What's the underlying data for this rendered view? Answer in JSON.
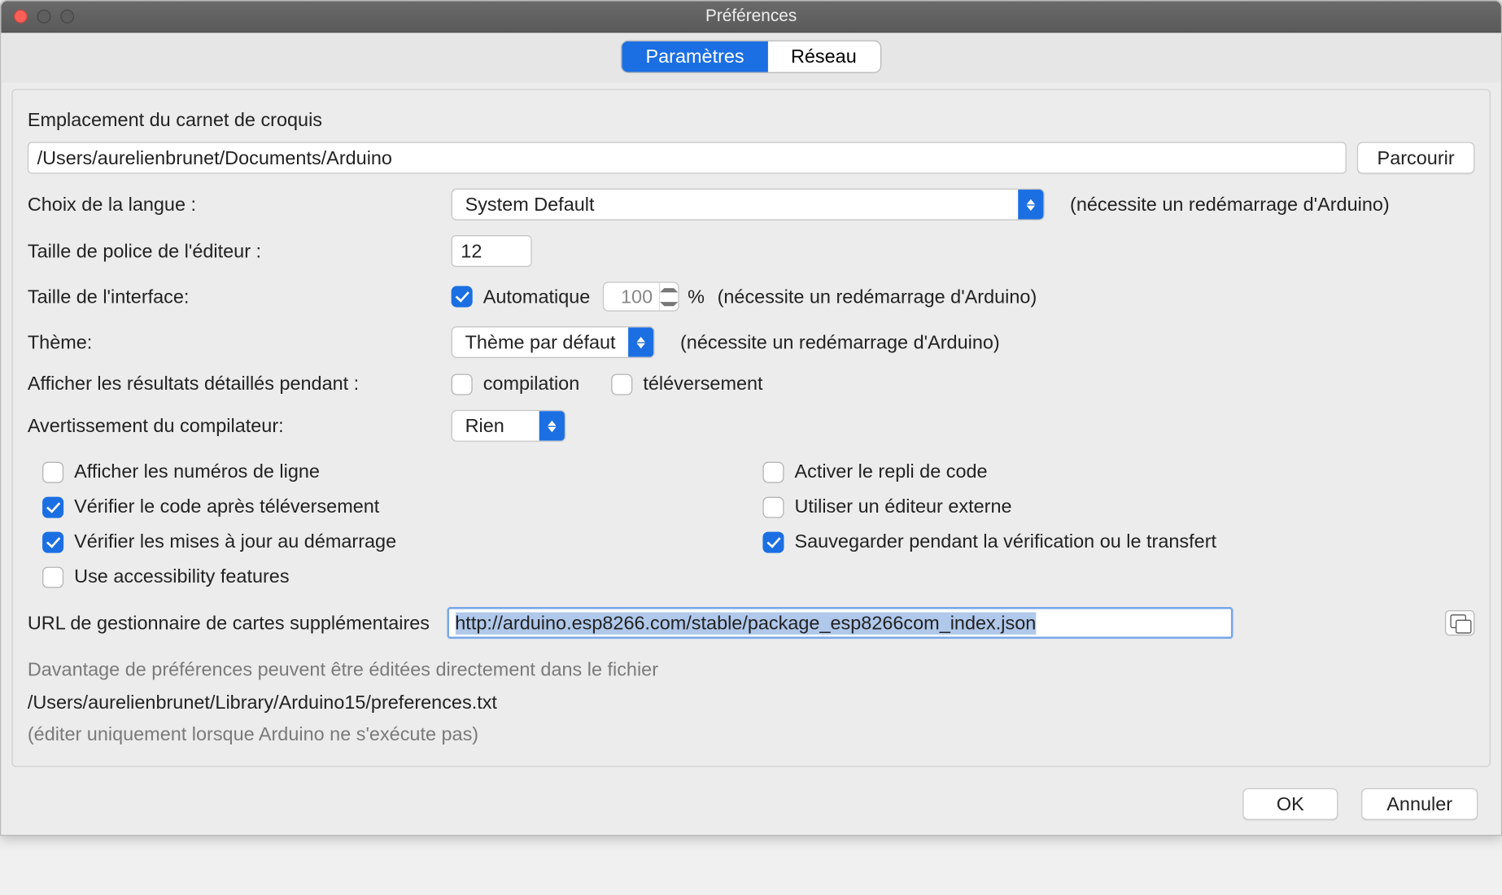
{
  "window": {
    "title": "Préférences"
  },
  "tabs": {
    "settings": "Paramètres",
    "network": "Réseau"
  },
  "sketchbook": {
    "label": "Emplacement du carnet de croquis",
    "path": "/Users/aurelienbrunet/Documents/Arduino",
    "browse": "Parcourir"
  },
  "language": {
    "label": "Choix de la langue :",
    "value": "System Default",
    "hint": "(nécessite un redémarrage d'Arduino)"
  },
  "fontsize": {
    "label": "Taille de police de l'éditeur :",
    "value": "12"
  },
  "uiscale": {
    "label": "Taille de l'interface:",
    "auto_label": "Automatique",
    "value": "100",
    "percent": "%",
    "hint": "(nécessite un redémarrage d'Arduino)"
  },
  "theme": {
    "label": "Thème:",
    "value": "Thème par défaut",
    "hint": "(nécessite un redémarrage d'Arduino)"
  },
  "verbose": {
    "label": "Afficher les résultats détaillés pendant :",
    "compilation": "compilation",
    "upload": "téléversement"
  },
  "warnings": {
    "label": "Avertissement du compilateur:",
    "value": "Rien"
  },
  "checks": {
    "line_numbers": "Afficher les numéros de ligne",
    "code_folding": "Activer le repli de code",
    "verify_after_upload": "Vérifier le code après téléversement",
    "external_editor": "Utiliser un éditeur externe",
    "check_updates": "Vérifier les mises à jour au démarrage",
    "save_on_verify": "Sauvegarder pendant la vérification ou le transfert",
    "accessibility": "Use accessibility features"
  },
  "boards_url": {
    "label": "URL de gestionnaire de cartes supplémentaires",
    "value": "http://arduino.esp8266.com/stable/package_esp8266com_index.json"
  },
  "more_prefs": {
    "line1": "Davantage de préférences peuvent être éditées directement dans le fichier",
    "path": "/Users/aurelienbrunet/Library/Arduino15/preferences.txt",
    "line2": "(éditer uniquement lorsque Arduino ne s'exécute pas)"
  },
  "buttons": {
    "ok": "OK",
    "cancel": "Annuler"
  }
}
